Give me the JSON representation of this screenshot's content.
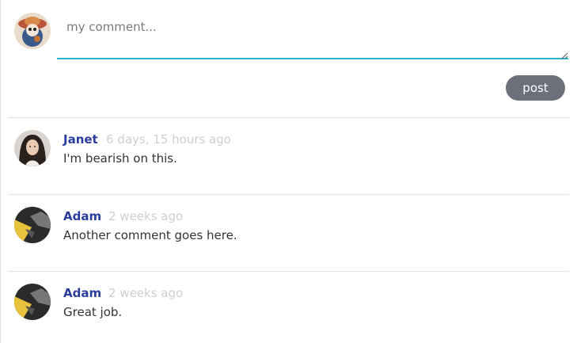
{
  "composer": {
    "placeholder": "my comment...",
    "post_label": "post"
  },
  "comments": [
    {
      "author": "Janet",
      "time": "6 days, 15 hours ago",
      "text": "I'm bearish on this.",
      "avatar": "woman-portrait"
    },
    {
      "author": "Adam",
      "time": "2 weeks ago",
      "text": "Another comment goes here.",
      "avatar": "yellow-dark-abstract"
    },
    {
      "author": "Adam",
      "time": "2 weeks ago",
      "text": "Great job.",
      "avatar": "yellow-dark-abstract"
    }
  ],
  "colors": {
    "accent_underline": "#2ab7cc",
    "author_name": "#2a3d9c",
    "timestamp": "#cfcfcf",
    "post_button": "#6c707b"
  }
}
